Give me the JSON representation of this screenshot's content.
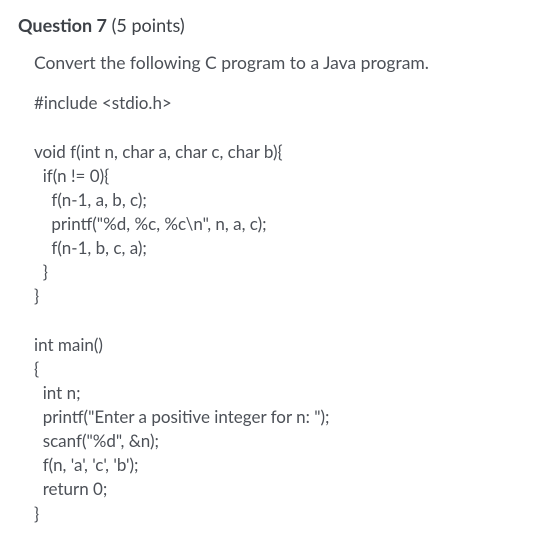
{
  "header": {
    "question_label": "Question 7",
    "points_label": "(5 points)"
  },
  "prompt": "Convert the following C program to a Java program.",
  "code": "#include <stdio.h>\n\nvoid f(int n, char a, char c, char b){\n  if(n != 0){\n    f(n-1, a, b, c);\n    printf(\"%d, %c, %c\\n\", n, a, c);\n    f(n-1, b, c, a);\n  }\n}\n\nint main()\n{\n  int n;\n  printf(\"Enter a positive integer for n: \");\n  scanf(\"%d\", &n);\n  f(n, 'a', 'c', 'b');\n  return 0;\n}"
}
